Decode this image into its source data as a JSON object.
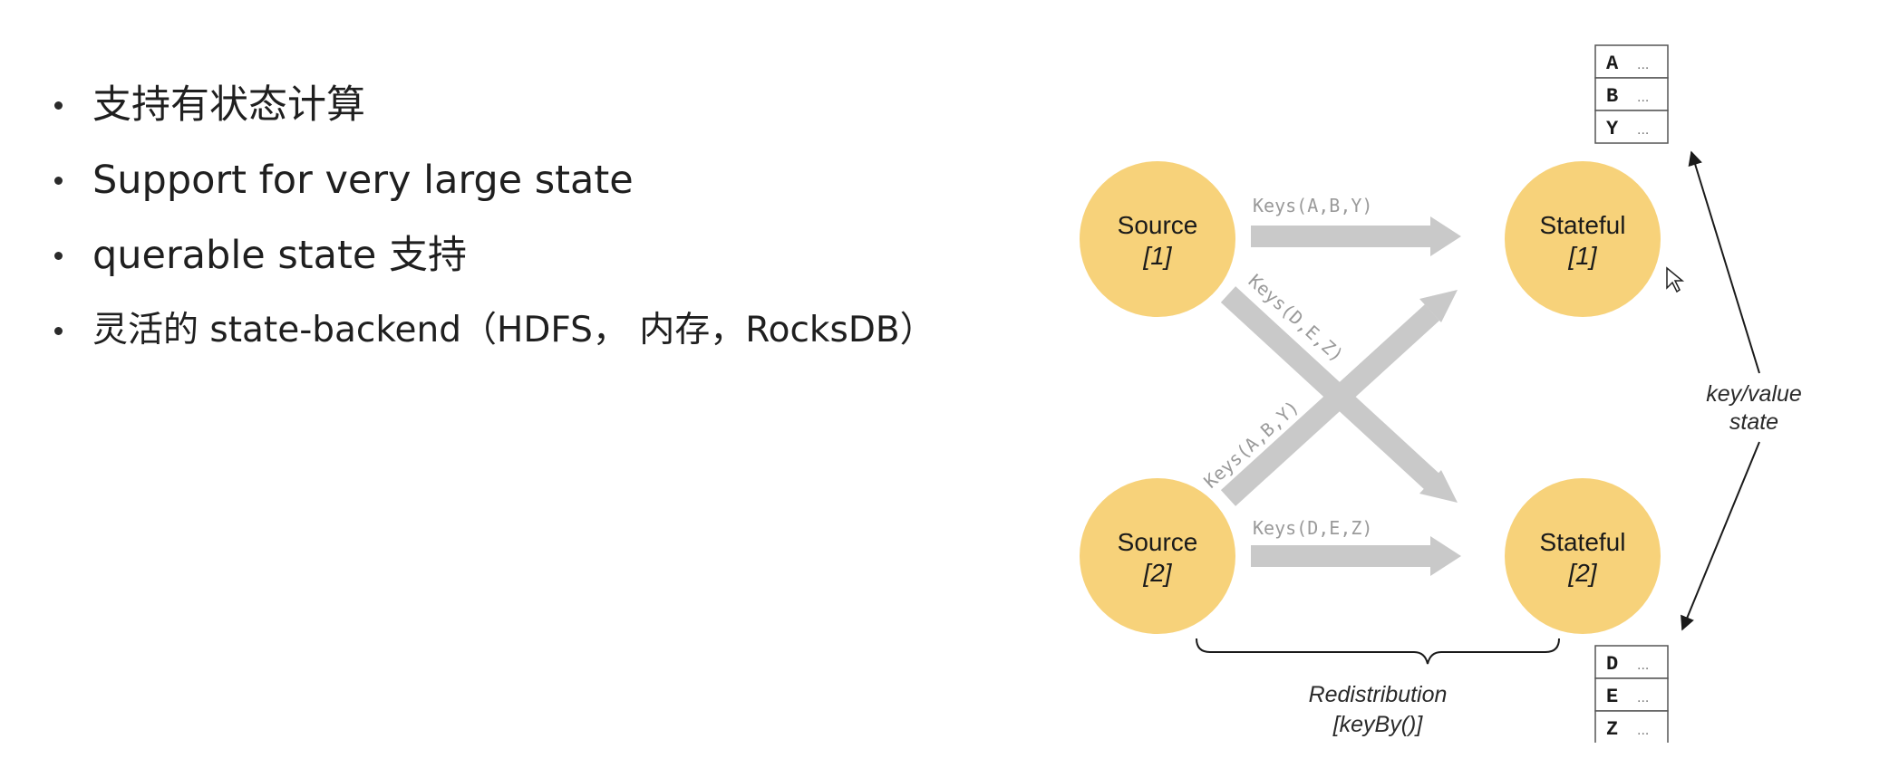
{
  "bullets": [
    "支持有状态计算",
    "Support for very large state",
    "querable state 支持",
    "灵活的 state-backend（HDFS， 内存，RocksDB）"
  ],
  "diagram": {
    "nodes": {
      "source1": {
        "name": "Source",
        "index": "[1]"
      },
      "source2": {
        "name": "Source",
        "index": "[2]"
      },
      "stateful1": {
        "name": "Stateful",
        "index": "[1]"
      },
      "stateful2": {
        "name": "Stateful",
        "index": "[2]"
      }
    },
    "edges": {
      "s1_to_st1": "Keys(A,B,Y)",
      "s1_to_st2": "Keys(D,E,Z)",
      "s2_to_st1": "Keys(A,B,Y)",
      "s2_to_st2": "Keys(D,E,Z)"
    },
    "state_tables": {
      "top": [
        {
          "key": "A",
          "value": "..."
        },
        {
          "key": "B",
          "value": "..."
        },
        {
          "key": "Y",
          "value": "..."
        }
      ],
      "bottom": [
        {
          "key": "D",
          "value": "..."
        },
        {
          "key": "E",
          "value": "..."
        },
        {
          "key": "Z",
          "value": "..."
        }
      ]
    },
    "side_note": {
      "line1": "key/value",
      "line2": "state"
    },
    "brace_note": {
      "line1": "Redistribution",
      "line2": "[keyBy()]"
    },
    "colors": {
      "node_fill": "#f7d27a",
      "arrow": "#c9c9c9",
      "text": "#1a1a1a"
    }
  }
}
